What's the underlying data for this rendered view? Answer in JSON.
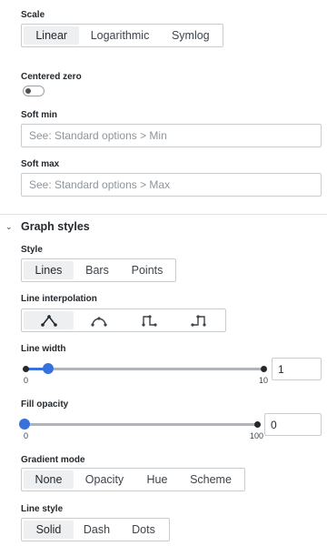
{
  "scale": {
    "label": "Scale",
    "options": [
      "Linear",
      "Logarithmic",
      "Symlog"
    ],
    "selected": "Linear"
  },
  "centered_zero": {
    "label": "Centered zero",
    "on": false
  },
  "soft_min": {
    "label": "Soft min",
    "placeholder": "See: Standard options > Min"
  },
  "soft_max": {
    "label": "Soft max",
    "placeholder": "See: Standard options > Max"
  },
  "graph_styles": {
    "title": "Graph styles",
    "style": {
      "label": "Style",
      "options": [
        "Lines",
        "Bars",
        "Points"
      ],
      "selected": "Lines"
    },
    "line_interpolation": {
      "label": "Line interpolation",
      "options": [
        "linear-icon",
        "smooth-icon",
        "step-before-icon",
        "step-after-icon"
      ],
      "selected": "linear-icon"
    },
    "line_width": {
      "label": "Line width",
      "min": "0",
      "max": "10",
      "value": "1",
      "fraction": 0.1
    },
    "fill_opacity": {
      "label": "Fill opacity",
      "min": "0",
      "max": "100",
      "value": "0",
      "fraction": 0.0
    },
    "gradient_mode": {
      "label": "Gradient mode",
      "options": [
        "None",
        "Opacity",
        "Hue",
        "Scheme"
      ],
      "selected": "None"
    },
    "line_style": {
      "label": "Line style",
      "options": [
        "Solid",
        "Dash",
        "Dots"
      ],
      "selected": "Solid"
    }
  },
  "colors": {
    "accent": "#3871dc",
    "active_bg": "#edeff1",
    "border": "#c7ccd1"
  }
}
